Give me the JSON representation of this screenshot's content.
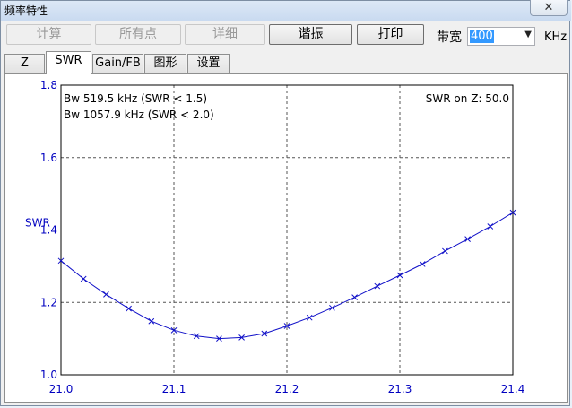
{
  "window": {
    "title": "频率特性",
    "close_glyph": "✕"
  },
  "toolbar": {
    "calc": "计算",
    "all_points": "所有点",
    "details": "详细",
    "resonance": "谐振",
    "print": "打印",
    "bandwidth_label": "带宽",
    "bandwidth_value": "400",
    "bandwidth_unit": "KHz"
  },
  "tabs": [
    "Z",
    "SWR",
    "Gain/FB",
    "图形",
    "设置"
  ],
  "active_tab": "SWR",
  "colors": {
    "curve": "#1010c8",
    "axis_text": "#0000c0",
    "grid": "#000000"
  },
  "chart_data": {
    "type": "line",
    "ylabel": "SWR",
    "xlim": [
      21.0,
      21.4
    ],
    "ylim": [
      1.0,
      1.8
    ],
    "xticks": [
      "21.0",
      "21.1",
      "21.2",
      "21.3",
      "21.4"
    ],
    "yticks": [
      "1.0",
      "1.2",
      "1.4",
      "1.6",
      "1.8"
    ],
    "grid": true,
    "annotations": [
      "Bw 519.5 kHz (SWR < 1.5)",
      "Bw 1057.9 kHz (SWR < 2.0)",
      "SWR on Z: 50.0"
    ],
    "series": [
      {
        "x": [
          21.0,
          21.02,
          21.04,
          21.06,
          21.08,
          21.1,
          21.12,
          21.14,
          21.16,
          21.18,
          21.2,
          21.22,
          21.24,
          21.26,
          21.28,
          21.3,
          21.32,
          21.34,
          21.36,
          21.38,
          21.4
        ],
        "y": [
          1.315,
          1.265,
          1.222,
          1.183,
          1.148,
          1.123,
          1.107,
          1.1,
          1.103,
          1.114,
          1.135,
          1.158,
          1.185,
          1.214,
          1.245,
          1.275,
          1.306,
          1.342,
          1.375,
          1.41,
          1.448
        ]
      }
    ]
  }
}
